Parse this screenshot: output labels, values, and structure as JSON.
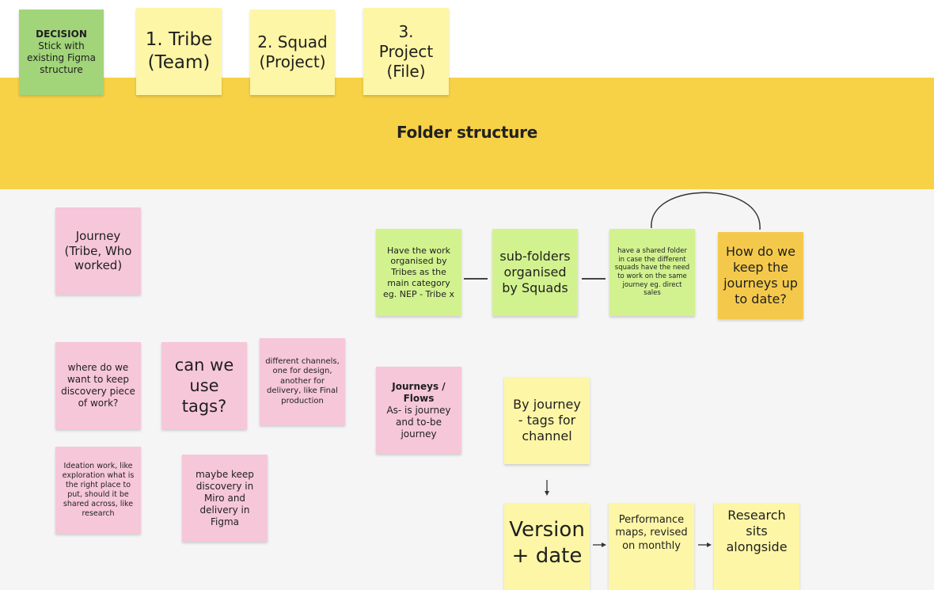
{
  "board": {
    "section_title": "Folder structure",
    "colors": {
      "band": "#f7d247",
      "canvas": "#f5f5f5",
      "yellow": "#fdf6a6",
      "green": "#d2f28f",
      "dark_green": "#a2d47a",
      "pink": "#f6c7d9",
      "orange": "#f4c94b"
    }
  },
  "notes": {
    "decision": {
      "title": "DECISION",
      "body": "Stick with existing Figma structure"
    },
    "tribe": "1. Tribe (Team)",
    "squad": "2. Squad (Project)",
    "project": "3.\nProject\n(File)",
    "journey_tribe": "Journey\n(Tribe, Who worked)",
    "work_by_tribes": "Have the work organised by Tribes as the main category eg. NEP - Tribe x",
    "subfolders": "sub-folders organised by Squads",
    "shared_folder": "have a shared folder in case the different squads have the need to work on the same journey eg. direct sales",
    "keep_journeys": "How do we keep the journeys up to date?",
    "discovery_place": "where do we want to keep discovery piece of work?",
    "tags": "can we use tags?",
    "channels": "different channels, one for design, another for delivery, like Final production",
    "journeys_flows": {
      "title": "Journeys / Flows",
      "body": "As- is journey and to-be journey"
    },
    "by_journey": "By journey - tags for channel",
    "ideation": "Ideation work, like exploration what is the right place to put, should it be shared across, like research",
    "miro_figma": "maybe keep discovery in Miro and delivery in Figma",
    "version": "Version\n+ date",
    "performance": "Performance maps, revised on monthly",
    "research": "Research sits alongside"
  }
}
